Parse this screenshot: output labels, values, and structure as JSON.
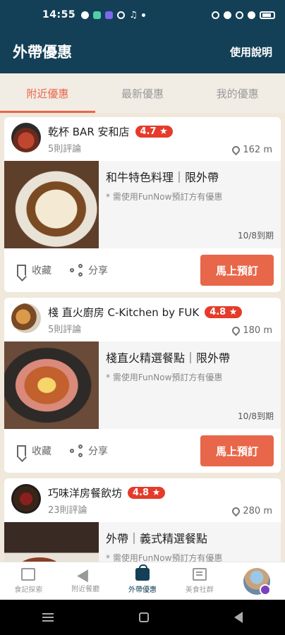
{
  "status_bar": {
    "time": "14:55"
  },
  "header": {
    "title": "外帶優惠",
    "help_label": "使用說明"
  },
  "tabs": [
    {
      "label": "附近優惠",
      "active": true
    },
    {
      "label": "最新優惠",
      "active": false
    },
    {
      "label": "我的優惠",
      "active": false
    }
  ],
  "cards": [
    {
      "store_name": "乾杯 BAR 安和店",
      "rating": "4.7 ★",
      "reviews": "5則評論",
      "distance": "162 m",
      "offer_title": "和牛特色料理｜限外帶",
      "offer_note": "* 需使用FunNow預訂方有優惠",
      "expiry": "10/8到期",
      "save_label": "收藏",
      "share_label": "分享",
      "book_label": "馬上預訂"
    },
    {
      "store_name": "棧 直火廚房 C-Kitchen by FUK",
      "rating": "4.8 ★",
      "reviews": "5則評論",
      "distance": "180 m",
      "offer_title": "棧直火精選餐點｜限外帶",
      "offer_note": "* 需使用FunNow預訂方有優惠",
      "expiry": "10/8到期",
      "save_label": "收藏",
      "share_label": "分享",
      "book_label": "馬上預訂"
    },
    {
      "store_name": "巧味洋房餐飲坊",
      "rating": "4.8 ★",
      "reviews": "23則評論",
      "distance": "280 m",
      "offer_title": "外帶｜義式精選餐點",
      "offer_note": "* 需使用FunNow預訂方有優惠"
    }
  ],
  "bottom_nav": [
    {
      "label": "食記探索",
      "icon": "explore-icon"
    },
    {
      "label": "附近餐廳",
      "icon": "nearby-icon"
    },
    {
      "label": "外帶優惠",
      "icon": "takeout-icon",
      "active": true
    },
    {
      "label": "美食社群",
      "icon": "community-icon"
    }
  ],
  "colors": {
    "primary": "#134056",
    "accent": "#e8674a",
    "rating": "#e53b2a"
  }
}
